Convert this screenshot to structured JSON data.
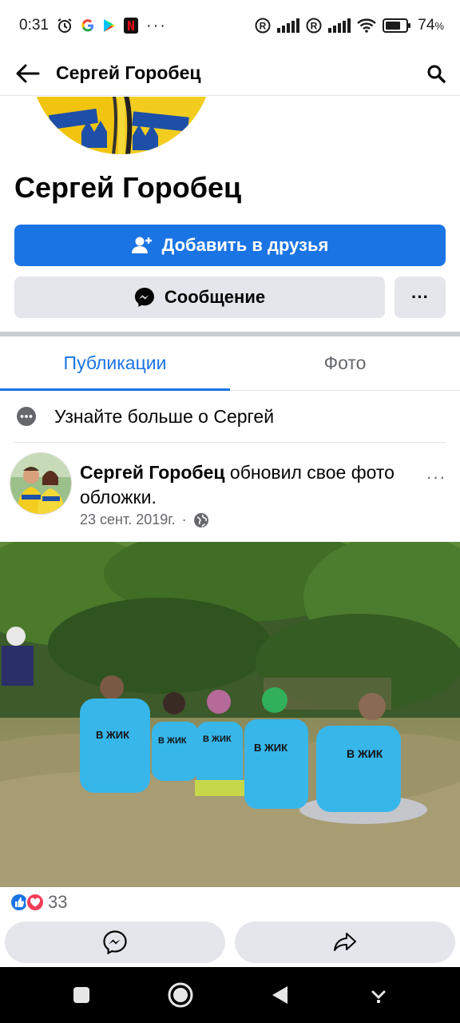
{
  "status_bar": {
    "time": "0:31",
    "battery": "74"
  },
  "header": {
    "title": "Сергей Горобец"
  },
  "profile": {
    "name": "Сергей Горобец",
    "add_friend_label": "Добавить в друзья",
    "message_label": "Сообщение",
    "more_label": "···"
  },
  "tabs": [
    {
      "label": "Публикации",
      "active": true
    },
    {
      "label": "Фото",
      "active": false
    }
  ],
  "learn_more": {
    "text": "Узнайте больше о Сергей"
  },
  "post": {
    "author": "Сергей Горобец",
    "action": " обновил свое фото обложки.",
    "date": "23 сент. 2019г.",
    "separator": "·",
    "options": "···",
    "reaction_count": "33"
  },
  "photo_text": {
    "shirt1": "В ЖИК",
    "shirt2": "В ЖИК",
    "shirt3": "В ЖИК",
    "shirt4": "В ЖИК",
    "shirt5": "В ЖИК"
  },
  "colors": {
    "accent": "#1b74e4",
    "secondary_button": "#e4e6eb",
    "muted_text": "#65676b"
  }
}
